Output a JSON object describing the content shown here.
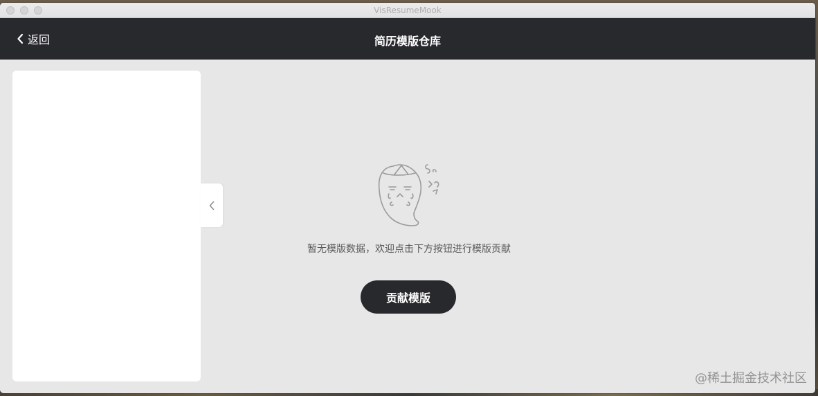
{
  "window": {
    "title": "VisResumeMook"
  },
  "appbar": {
    "back_label": "返回",
    "title": "简历模版仓库"
  },
  "empty_state": {
    "message": "暂无模版数据，欢迎点击下方按钮进行模版贡献",
    "illustration": "crying-ghost-illustration"
  },
  "actions": {
    "contribute_label": "贡献模版"
  },
  "watermark": "@稀土掘金技术社区",
  "colors": {
    "appbar": "#28292d",
    "content_bg": "#e7e7e7",
    "panel": "#ffffff",
    "button": "#28292d",
    "button_text": "#ffffff"
  }
}
